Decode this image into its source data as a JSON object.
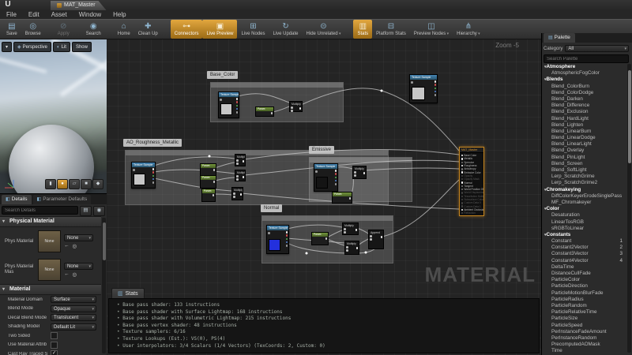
{
  "window": {
    "logo_glyph": "U",
    "tab_title": "MAT_Master",
    "menu": [
      "File",
      "Edit",
      "Asset",
      "Window",
      "Help"
    ]
  },
  "toolbar": {
    "buttons": [
      {
        "label": "Save",
        "glyph": "▤"
      },
      {
        "label": "Browse",
        "glyph": "◎"
      },
      {
        "label": "Apply",
        "glyph": "⊘",
        "disabled": true,
        "gap": true
      },
      {
        "label": "Search",
        "glyph": "◉",
        "gap": true
      },
      {
        "label": "Home",
        "glyph": "⌂",
        "gap": true
      },
      {
        "label": "Clean Up",
        "glyph": "✚"
      },
      {
        "label": "Connectors",
        "glyph": "⊶",
        "active": true,
        "gap": true
      },
      {
        "label": "Live Preview",
        "glyph": "▣",
        "active": true
      },
      {
        "label": "Live Nodes",
        "glyph": "⊞"
      },
      {
        "label": "Live Update",
        "glyph": "↻"
      },
      {
        "label": "Hide Unrelated",
        "glyph": "⊝",
        "dropdown": true
      },
      {
        "label": "Stats",
        "glyph": "▥",
        "active": true,
        "gap": true
      },
      {
        "label": "Platform Stats",
        "glyph": "⊟"
      },
      {
        "label": "Preview Nodes",
        "glyph": "◫",
        "dropdown": true
      },
      {
        "label": "Hierarchy",
        "glyph": "⋔",
        "dropdown": true
      }
    ]
  },
  "viewport": {
    "dropdown_glyph": "▾",
    "buttons": {
      "perspective": "Perspective",
      "lit": "Lit",
      "show": "Show"
    },
    "icons": {
      "perspective": "◈",
      "lit": "◐"
    },
    "mesh_buttons": [
      {
        "name": "cylinder",
        "glyph": "▮"
      },
      {
        "name": "sphere",
        "glyph": "●",
        "active": true
      },
      {
        "name": "plane",
        "glyph": "▱"
      },
      {
        "name": "cube",
        "glyph": "■"
      },
      {
        "name": "custom-mesh",
        "glyph": "◆"
      }
    ]
  },
  "details": {
    "tabs": {
      "details": "Details",
      "parameter_defaults": "Parameter Defaults"
    },
    "tab_icon": "◧",
    "search_placeholder": "Search Details",
    "filter_icon": "▤",
    "eye_icon": "◉",
    "physical_material": {
      "section": "Physical Material",
      "rows": [
        {
          "label": "Phys Material",
          "thumb": "None",
          "value": "None",
          "back_icon": "←",
          "browse_icon": "◎"
        },
        {
          "label": "Phys Material Mas",
          "thumb": "None",
          "value": "None",
          "back_icon": "←",
          "browse_icon": "◎"
        }
      ]
    },
    "material": {
      "section": "Material",
      "dropdown_rows": [
        {
          "label": "Material Domain",
          "value": "Surface"
        },
        {
          "label": "Blend Mode",
          "value": "Opaque"
        },
        {
          "label": "Decal Blend Mode",
          "value": "Translucent",
          "disabled": true
        },
        {
          "label": "Shading Model",
          "value": "Default Lit"
        }
      ],
      "checkbox_rows": [
        {
          "label": "Two Sided",
          "checked": false
        },
        {
          "label": "Use Material Attrib",
          "checked": false
        },
        {
          "label": "Cast Ray Traced S",
          "checked": true
        }
      ]
    }
  },
  "graph": {
    "zoom_label": "Zoom -5",
    "watermark": "MATERIAL",
    "comments": {
      "base_color": "Base_Color",
      "ao": "AO_Roughness_Metallic",
      "emissive": "Emissive",
      "normal": "Normal"
    },
    "node_titles": {
      "texture": "Texture Sample",
      "param": "Param",
      "multiply": "Multiply",
      "append": "Append"
    },
    "main_node": {
      "title": "MAT_Master",
      "pins": [
        {
          "label": "Base Color",
          "connected": true
        },
        {
          "label": "Metallic",
          "connected": true
        },
        {
          "label": "Specular"
        },
        {
          "label": "Roughness",
          "connected": true
        },
        {
          "label": "Anisotropy"
        },
        {
          "label": "Emissive Color",
          "connected": true
        },
        {
          "label": "Opacity",
          "disabled": true
        },
        {
          "label": "Opacity Mask",
          "disabled": true
        },
        {
          "label": "Normal",
          "connected": true
        },
        {
          "label": "Tangent"
        },
        {
          "label": "World Position Offset"
        },
        {
          "label": "World Displacement",
          "disabled": true
        },
        {
          "label": "Tessellation Multiplier",
          "disabled": true
        },
        {
          "label": "Subsurface Color",
          "disabled": true
        },
        {
          "label": "Custom Data 0",
          "disabled": true
        },
        {
          "label": "Custom Data 1",
          "disabled": true
        },
        {
          "label": "Ambient Occlusion",
          "connected": true
        },
        {
          "label": "Refraction",
          "disabled": true
        }
      ]
    }
  },
  "stats": {
    "tab": "Stats",
    "tab_icon": "▥",
    "lines": [
      "Base pass shader: 133 instructions",
      "Base pass shader with Surface Lightmap: 168 instructions",
      "Base pass shader with Volumetric Lightmap: 215 instructions",
      "Base pass vertex shader: 48 instructions",
      "Texture samplers: 6/16",
      "Texture Lookups (Est.): VS(0), PS(4)",
      "User interpolators: 3/4 Scalars (1/4 Vectors) (TexCoords: 2, Custom: 0)"
    ]
  },
  "palette": {
    "tab": "Palette",
    "tab_icon": "▤",
    "category_label": "Category",
    "category_value": "All",
    "search_placeholder": "Search Palette",
    "items": [
      {
        "label": "Atmosphere",
        "header": true
      },
      {
        "label": "AtmosphericFogColor"
      },
      {
        "label": "Blends",
        "header": true
      },
      {
        "label": "Blend_ColorBurn"
      },
      {
        "label": "Blend_ColorDodge"
      },
      {
        "label": "Blend_Darken"
      },
      {
        "label": "Blend_Difference"
      },
      {
        "label": "Blend_Exclusion"
      },
      {
        "label": "Blend_HardLight"
      },
      {
        "label": "Blend_Lighten"
      },
      {
        "label": "Blend_LinearBurn"
      },
      {
        "label": "Blend_LinearDodge"
      },
      {
        "label": "Blend_LinearLight"
      },
      {
        "label": "Blend_Overlay"
      },
      {
        "label": "Blend_PinLight"
      },
      {
        "label": "Blend_Screen"
      },
      {
        "label": "Blend_SoftLight"
      },
      {
        "label": "Lerp_ScratchGrime"
      },
      {
        "label": "Lerp_ScratchGrime2"
      },
      {
        "label": "Chromakeying",
        "header": true
      },
      {
        "label": "DiffColorKeyerErodeSinglePass"
      },
      {
        "label": "MF_Chromakeyer"
      },
      {
        "label": "Color",
        "header": true
      },
      {
        "label": "Desaturation"
      },
      {
        "label": "LinearTosRGB"
      },
      {
        "label": "sRGBToLinear"
      },
      {
        "label": "Constants",
        "header": true
      },
      {
        "label": "Constant",
        "badge": "1"
      },
      {
        "label": "Constant2Vector",
        "badge": "2"
      },
      {
        "label": "Constant3Vector",
        "badge": "3"
      },
      {
        "label": "Constant4Vector",
        "badge": "4"
      },
      {
        "label": "DeltaTime"
      },
      {
        "label": "DistanceCullFade"
      },
      {
        "label": "ParticleColor"
      },
      {
        "label": "ParticleDirection"
      },
      {
        "label": "ParticleMotionBlurFade"
      },
      {
        "label": "ParticleRadius"
      },
      {
        "label": "ParticleRandom"
      },
      {
        "label": "ParticleRelativeTime"
      },
      {
        "label": "ParticleSize"
      },
      {
        "label": "ParticleSpeed"
      },
      {
        "label": "PerInstanceFadeAmount"
      },
      {
        "label": "PerInstanceRandom"
      },
      {
        "label": "PrecomputedAOMask"
      },
      {
        "label": "Time"
      }
    ]
  },
  "colors": {
    "accent_orange": "#d9973a",
    "node_header_blue": "#3a79a8",
    "node_header_green": "#6b8c38",
    "wire": "#cfcfcf"
  }
}
